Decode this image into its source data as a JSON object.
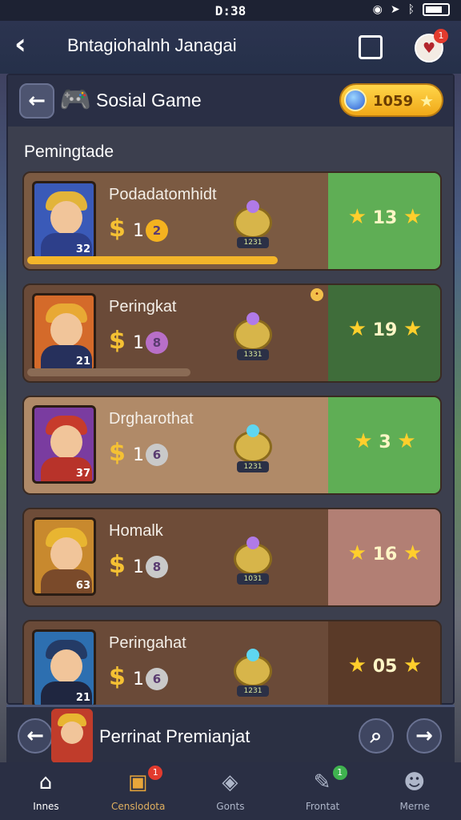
{
  "status_bar": {
    "time": "D:38"
  },
  "app_bar": {
    "title": "Bntagiohalnh Janagai",
    "notification_badge": "1"
  },
  "game_header": {
    "title": "Sosial Game",
    "coins": "1059"
  },
  "section": {
    "title": "Pemingtade"
  },
  "rows": [
    {
      "name": "Podadatomhidt",
      "level": "32",
      "multiplier": "1",
      "coin": "2",
      "trophy_label": "1231",
      "score": "13",
      "left_color": "#7b5a42",
      "right_color": "#5fae55",
      "coin_color": "#f4b21f",
      "hair_color": "#e2b43a",
      "body_color": "#2d3f8a",
      "gem_color": "#b07ae8",
      "progress": 0.92
    },
    {
      "name": "Peringkat",
      "level": "21",
      "multiplier": "1",
      "coin": "8",
      "trophy_label": "1331",
      "score": "19",
      "left_color": "#6a4a38",
      "right_color": "#3f6d3a",
      "coin_color": "#b86fc8",
      "hair_color": "#e8a934",
      "body_color": "#26305c",
      "gem_color": "#b07ae8",
      "progress": 0.6
    },
    {
      "name": "Drgharothat",
      "level": "37",
      "multiplier": "1",
      "coin": "6",
      "trophy_label": "1231",
      "score": "3",
      "left_color": "#b08a68",
      "right_color": "#5fae55",
      "coin_color": "#c9c9c9",
      "hair_color": "#c73b2b",
      "body_color": "#b8332a",
      "gem_color": "#5fd6f0",
      "progress": 0
    },
    {
      "name": "Homalk",
      "level": "63",
      "multiplier": "1",
      "coin": "8",
      "trophy_label": "1031",
      "score": "16",
      "left_color": "#6e4c38",
      "right_color": "#b27f74",
      "coin_color": "#c9c9c9",
      "hair_color": "#e8b531",
      "body_color": "#7a4a2a",
      "gem_color": "#b07ae8",
      "progress": 0
    },
    {
      "name": "Peringahat",
      "level": "21",
      "multiplier": "1",
      "coin": "6",
      "trophy_label": "1231",
      "score": "05",
      "left_color": "#6a4a38",
      "right_color": "#5a3a28",
      "coin_color": "#c9c9c9",
      "hair_color": "#243b66",
      "body_color": "#1f2640",
      "gem_color": "#5fd6f0",
      "progress": 0
    }
  ],
  "bottom_bar": {
    "label": "Perrinat Premianjat"
  },
  "nav": [
    {
      "label": "Innes",
      "icon": "home-icon",
      "glyph": "⌂"
    },
    {
      "label": "Censlodota",
      "icon": "shop-icon",
      "glyph": "▣",
      "badge": "1"
    },
    {
      "label": "Gonts",
      "icon": "shield-icon",
      "glyph": "◈"
    },
    {
      "label": "Frontat",
      "icon": "feather-icon",
      "glyph": "✎",
      "badge": "1"
    },
    {
      "label": "Merne",
      "icon": "profile-icon",
      "glyph": "☻"
    }
  ]
}
